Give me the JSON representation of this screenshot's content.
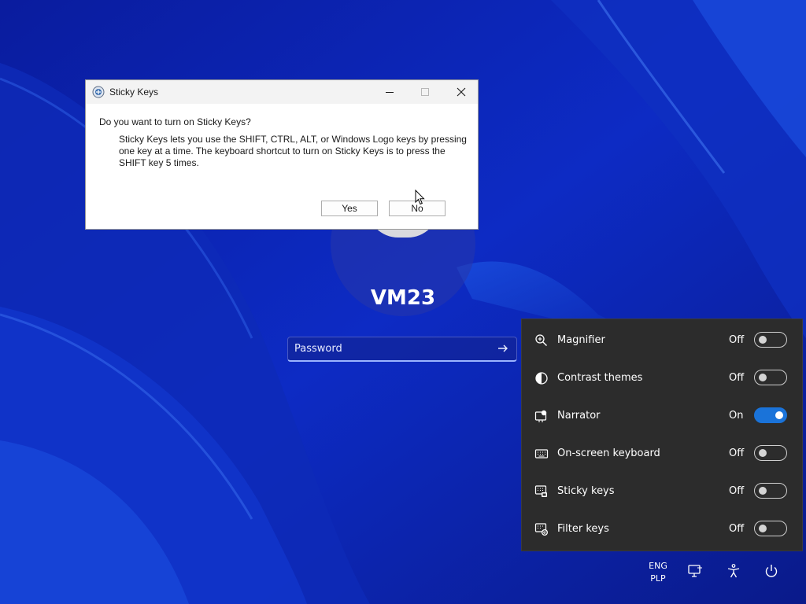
{
  "login": {
    "username": "VM23",
    "password_placeholder": "Password"
  },
  "dialog": {
    "title": "Sticky Keys",
    "question": "Do you want to turn on Sticky Keys?",
    "body": "Sticky Keys lets you use the SHIFT, CTRL, ALT, or Windows Logo keys by pressing one key at a time. The keyboard shortcut to turn on Sticky Keys is to press the SHIFT key 5 times.",
    "yes_label": "Yes",
    "no_label": "No"
  },
  "accessibility": {
    "items": [
      {
        "label": "Magnifier",
        "state": "Off",
        "on": false,
        "icon": "magnifier-icon"
      },
      {
        "label": "Contrast themes",
        "state": "Off",
        "on": false,
        "icon": "contrast-icon"
      },
      {
        "label": "Narrator",
        "state": "On",
        "on": true,
        "icon": "narrator-icon"
      },
      {
        "label": "On-screen keyboard",
        "state": "Off",
        "on": false,
        "icon": "keyboard-icon"
      },
      {
        "label": "Sticky keys",
        "state": "Off",
        "on": false,
        "icon": "sticky-keys-icon"
      },
      {
        "label": "Filter keys",
        "state": "Off",
        "on": false,
        "icon": "filter-keys-icon"
      }
    ],
    "accent_color": "#1a73d9"
  },
  "tray": {
    "lang_line1": "ENG",
    "lang_line2": "PLP"
  }
}
